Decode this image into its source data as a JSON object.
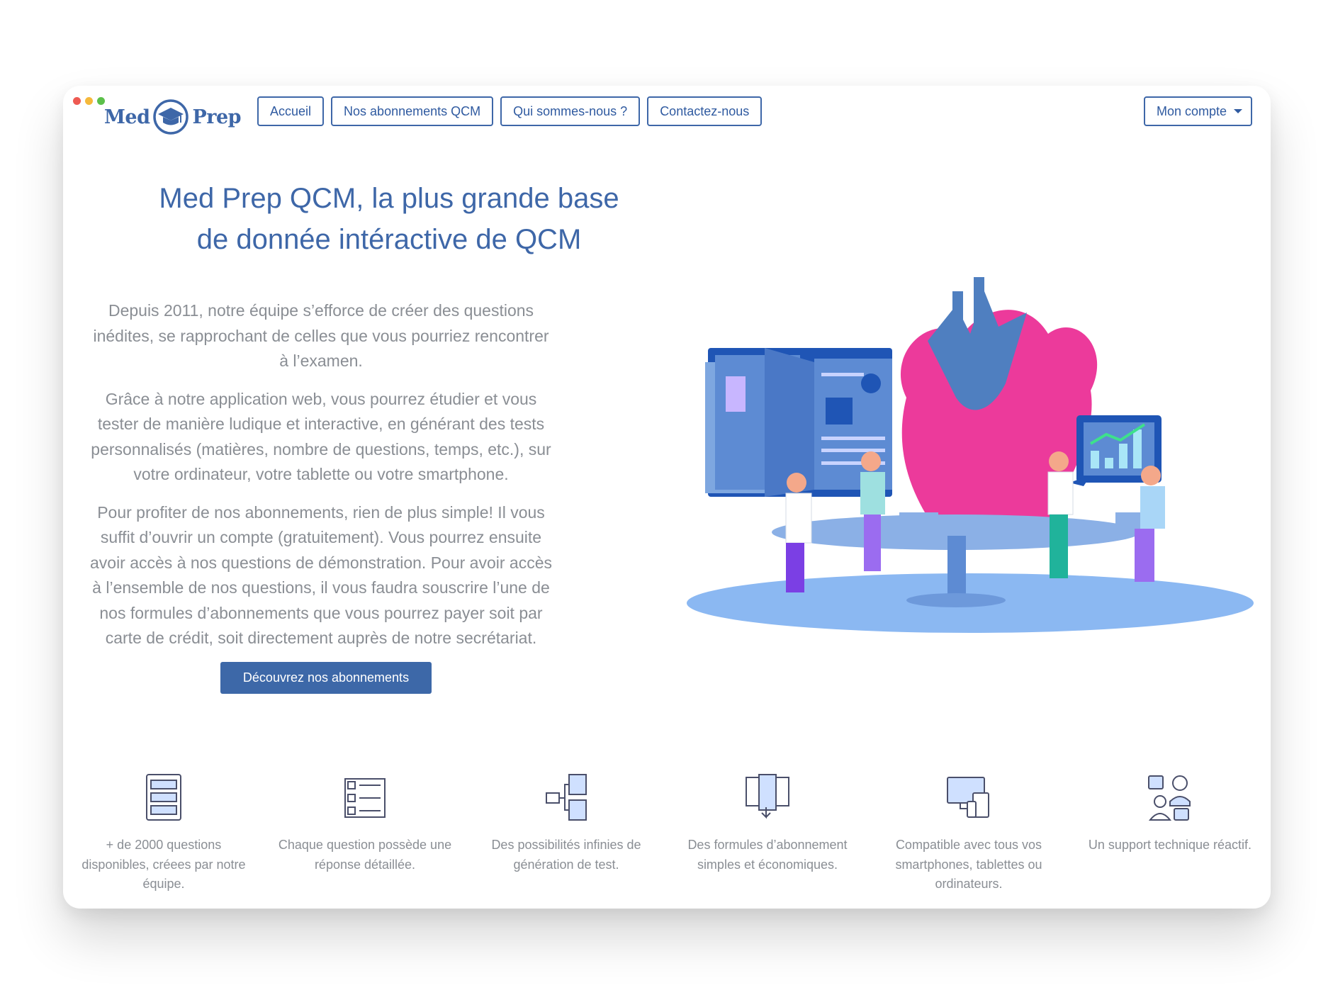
{
  "logo": {
    "left": "Med",
    "right": "Prep"
  },
  "nav": {
    "items": [
      {
        "label": "Accueil"
      },
      {
        "label": "Nos abonnements QCM"
      },
      {
        "label": "Qui sommes-nous ?"
      },
      {
        "label": "Contactez-nous"
      }
    ],
    "account": "Mon compte"
  },
  "hero": {
    "title_line1": "Med Prep QCM, la plus grande base",
    "title_line2": "de donnée intéractive de QCM",
    "paragraphs": [
      "Depuis 2011, notre équipe s’efforce de créer des questions inédites, se rapprochant de celles que vous pourriez rencontrer à l’examen.",
      "Grâce à notre application web, vous pourrez étudier et vous tester de manière ludique et interactive, en générant des tests personnalisés (matières, nombre de questions, temps, etc.), sur votre ordinateur, votre tablette ou votre smartphone.",
      "Pour profiter de nos abonnements, rien de plus simple! Il vous suffit d’ouvrir un compte (gratuitement). Vous pourrez ensuite avoir accès à nos questions de démonstration. Pour avoir accès à l’ensemble de nos questions, il vous faudra souscrire l’une de nos formules d’abonnements que vous pourrez payer soit par carte de crédit, soit directement auprès de notre secrétariat."
    ],
    "cta": "Découvrez nos abonnements"
  },
  "features": [
    {
      "icon": "question-list-icon",
      "text": "+ de 2000 questions disponibles, créees par notre équipe."
    },
    {
      "icon": "answer-form-icon",
      "text": "Chaque question possède une réponse détaillée."
    },
    {
      "icon": "test-generation-icon",
      "text": "Des possibilités infinies de génération de test."
    },
    {
      "icon": "subscription-icon",
      "text": "Des formules d’abonnement simples et économiques."
    },
    {
      "icon": "devices-icon",
      "text": "Compatible avec tous vos smartphones, tablettes ou ordinateurs."
    },
    {
      "icon": "support-icon",
      "text": "Un support technique réactif."
    }
  ],
  "colors": {
    "brand": "#3e67a8",
    "text_muted": "#8a8e94",
    "heart_pink": "#ec3a9b",
    "illustration_blue": "#4f7fc0",
    "accent_purple": "#7b3fe4"
  }
}
